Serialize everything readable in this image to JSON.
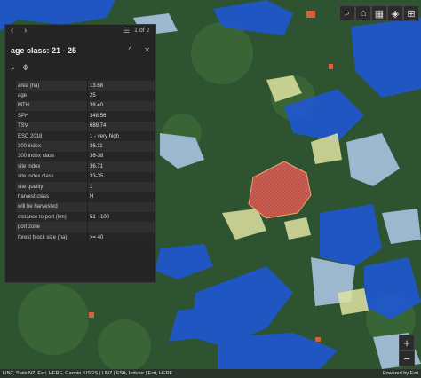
{
  "toolbar": {
    "buttons": [
      {
        "name": "search-icon",
        "glyph": "⌕"
      },
      {
        "name": "home-icon",
        "glyph": "⌂"
      },
      {
        "name": "map-icon",
        "glyph": "▦"
      },
      {
        "name": "layers-icon",
        "glyph": "◈"
      },
      {
        "name": "basemap-icon",
        "glyph": "⊞"
      }
    ]
  },
  "popup": {
    "page_indicator": "1 of 2",
    "prev_glyph": "‹",
    "next_glyph": "›",
    "list_glyph": "☰",
    "title": "age class: 21 - 25",
    "collapse_glyph": "^",
    "close_glyph": "✕",
    "zoom_glyph": "⌕",
    "move_glyph": "✥",
    "rows": [
      {
        "key": "area (ha)",
        "value": "13.68"
      },
      {
        "key": "age",
        "value": "25"
      },
      {
        "key": "MTH",
        "value": "38.40"
      },
      {
        "key": "SPH",
        "value": "348.56"
      },
      {
        "key": "TSV",
        "value": "689.74"
      },
      {
        "key": "ESC 2018",
        "value": "1 - very high"
      },
      {
        "key": "300 index",
        "value": "36.11"
      },
      {
        "key": "300 index class",
        "value": "36-38"
      },
      {
        "key": "site index",
        "value": "36.71"
      },
      {
        "key": "site index class",
        "value": "33-35"
      },
      {
        "key": "site quality",
        "value": "1"
      },
      {
        "key": "harvest class",
        "value": "H"
      },
      {
        "key": "will be harvested",
        "value": ""
      },
      {
        "key": "distance to port (km)",
        "value": "51 - 100"
      },
      {
        "key": "port zone",
        "value": ""
      },
      {
        "key": "forest block size (ha)",
        "value": ">= 40"
      }
    ]
  },
  "zoom": {
    "in": "+",
    "out": "−"
  },
  "attribution": {
    "text": "LINZ, Stats NZ, Esri, HERE, Garmin, USGS | LINZ | ESA, Indufor | Esri, HERE",
    "powered": "Powered by Esri"
  },
  "colors": {
    "accent": "#1e5bd6",
    "forest": "#2f5a2c",
    "highlight": "#e0623c"
  }
}
